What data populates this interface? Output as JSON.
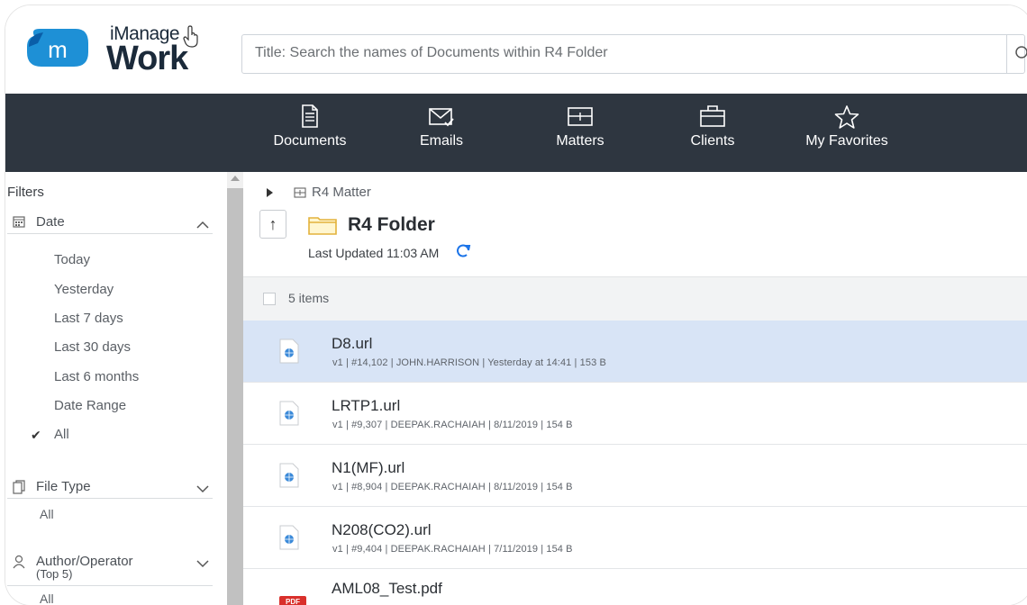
{
  "app": {
    "logo_small": "iManage",
    "logo_big": "Work",
    "logo_badge": "m"
  },
  "search": {
    "placeholder": "Title: Search the names of Documents within R4 Folder"
  },
  "nav": {
    "items": [
      {
        "label": "Documents",
        "icon": "document-icon"
      },
      {
        "label": "Emails",
        "icon": "email-icon"
      },
      {
        "label": "Matters",
        "icon": "matter-icon"
      },
      {
        "label": "Clients",
        "icon": "briefcase-icon"
      },
      {
        "label": "My Favorites",
        "icon": "star-icon"
      }
    ]
  },
  "filters": {
    "title": "Filters",
    "date": {
      "label": "Date",
      "options": [
        "Today",
        "Yesterday",
        "Last 7 days",
        "Last 30 days",
        "Last 6 months",
        "Date Range",
        "All"
      ],
      "selected": "All",
      "check": "✔"
    },
    "file_type": {
      "label": "File Type",
      "value": "All"
    },
    "author": {
      "label": "Author/Operator",
      "sublabel": "(Top 5)",
      "value": "All"
    }
  },
  "location": {
    "breadcrumb": "R4 Matter",
    "folder_name": "R4 Folder",
    "last_updated": "Last Updated 11:03 AM",
    "up_arrow": "↑"
  },
  "list": {
    "count_label": "5 items",
    "items": [
      {
        "name": "D8.url",
        "meta": "v1 | #14,102 | JOHN.HARRISON | Yesterday at 14:41 | 153 B",
        "type": "url",
        "selected": true
      },
      {
        "name": "LRTP1.url",
        "meta": "v1 | #9,307 | DEEPAK.RACHAIAH | 8/11/2019 | 154 B",
        "type": "url",
        "selected": false
      },
      {
        "name": "N1(MF).url",
        "meta": "v1 | #8,904 | DEEPAK.RACHAIAH | 8/11/2019 | 154 B",
        "type": "url",
        "selected": false
      },
      {
        "name": "N208(CO2).url",
        "meta": "v1 | #9,404 | DEEPAK.RACHAIAH | 7/11/2019 | 154 B",
        "type": "url",
        "selected": false
      },
      {
        "name": "AML08_Test.pdf",
        "meta": "",
        "type": "pdf",
        "selected": false,
        "badge": "PDF"
      }
    ]
  },
  "colors": {
    "nav_bg": "#2e3640",
    "selected_row": "#d8e4f6",
    "accent": "#1a73e8"
  }
}
